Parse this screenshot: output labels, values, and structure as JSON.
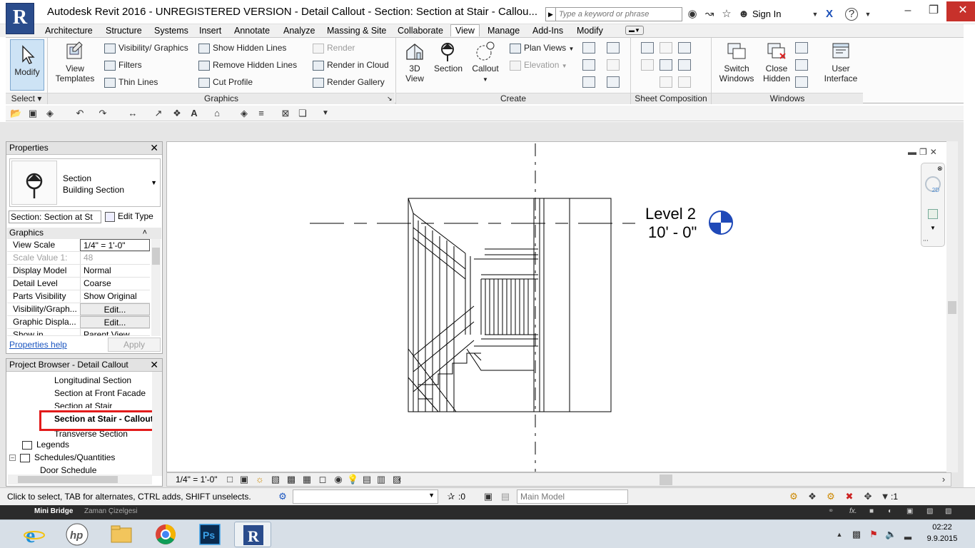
{
  "window": {
    "app_title": "Autodesk Revit 2016 - UNREGISTERED VERSION -",
    "doc_title": "Detail Callout - Section: Section at Stair - Callou...",
    "app_logo": "R",
    "search_placeholder": "Type a keyword or phrase",
    "sign_in": "Sign In"
  },
  "ribbon": {
    "tabs": [
      {
        "label": "Architecture"
      },
      {
        "label": "Structure"
      },
      {
        "label": "Systems"
      },
      {
        "label": "Insert"
      },
      {
        "label": "Annotate"
      },
      {
        "label": "Analyze"
      },
      {
        "label": "Massing & Site"
      },
      {
        "label": "Collaborate"
      },
      {
        "label": "View",
        "active": true
      },
      {
        "label": "Manage"
      },
      {
        "label": "Add-Ins"
      },
      {
        "label": "Modify"
      }
    ],
    "panels": {
      "select": "Select",
      "graphics": "Graphics",
      "create": "Create",
      "sheet_composition": "Sheet Composition",
      "windows": "Windows"
    },
    "buttons": {
      "modify": "Modify",
      "view_templates_1": "View",
      "view_templates_2": "Templates",
      "visibility_graphics": "Visibility/ Graphics",
      "filters": "Filters",
      "thin_lines": "Thin  Lines",
      "show_hidden_lines": "Show  Hidden Lines",
      "remove_hidden_lines": "Remove  Hidden Lines",
      "cut_profile": "Cut  Profile",
      "render": "Render",
      "render_in_cloud": "Render  in Cloud",
      "render_gallery": "Render  Gallery",
      "view_3d_1": "3D",
      "view_3d_2": "View",
      "section": "Section",
      "callout": "Callout",
      "plan_views": "Plan  Views",
      "elevation": "Elevation",
      "switch_windows_1": "Switch",
      "switch_windows_2": "Windows",
      "close_hidden_1": "Close",
      "close_hidden_2": "Hidden",
      "user_interface_1": "User",
      "user_interface_2": "Interface"
    }
  },
  "properties": {
    "title": "Properties",
    "type_family": "Section",
    "type_name": "Building Section",
    "instance_selector": "Section: Section at St",
    "edit_type": "Edit Type",
    "group": "Graphics",
    "rows": [
      {
        "key": "View Scale",
        "value": "1/4\" = 1'-0\""
      },
      {
        "key": "Scale Value    1:",
        "value": "48"
      },
      {
        "key": "Display Model",
        "value": "Normal"
      },
      {
        "key": "Detail Level",
        "value": "Coarse"
      },
      {
        "key": "Parts Visibility",
        "value": "Show Original"
      },
      {
        "key": "Visibility/Graph...",
        "value": "Edit..."
      },
      {
        "key": "Graphic Displa...",
        "value": "Edit..."
      },
      {
        "key": "Show in",
        "value": "Parent View"
      }
    ],
    "help_link": "Properties help",
    "apply": "Apply"
  },
  "browser": {
    "title": "Project Browser - Detail Callout",
    "items": [
      {
        "label": "Longitudinal Section"
      },
      {
        "label": "Section at Front Facade"
      },
      {
        "label": "Section at Stair"
      },
      {
        "label": "Section at Stair - Callout",
        "selected": true
      },
      {
        "label": "Transverse Section"
      },
      {
        "label": "Legends"
      },
      {
        "label": "Schedules/Quantities"
      },
      {
        "label": "Door Schedule"
      }
    ]
  },
  "canvas": {
    "level_name": "Level 2",
    "level_elevation": "10' - 0\""
  },
  "view_controls": {
    "scale": "1/4\" = 1'-0\""
  },
  "status": {
    "message": "Click to select, TAB for alternates, CTRL adds, SHIFT unselects.",
    "selection_count": ":0",
    "workset": "Main Model",
    "filter_count": ":1"
  },
  "mini_bridge": {
    "tab1": "Mini Bridge",
    "tab2": "Zaman Çizelgesi"
  },
  "taskbar": {
    "time": "02:22",
    "date": "9.9.2015"
  },
  "colors": {
    "accent": "#2a4c8c",
    "highlight": "#e21b1b",
    "close_button": "#c7312b",
    "level_head": "#1f49b8"
  }
}
